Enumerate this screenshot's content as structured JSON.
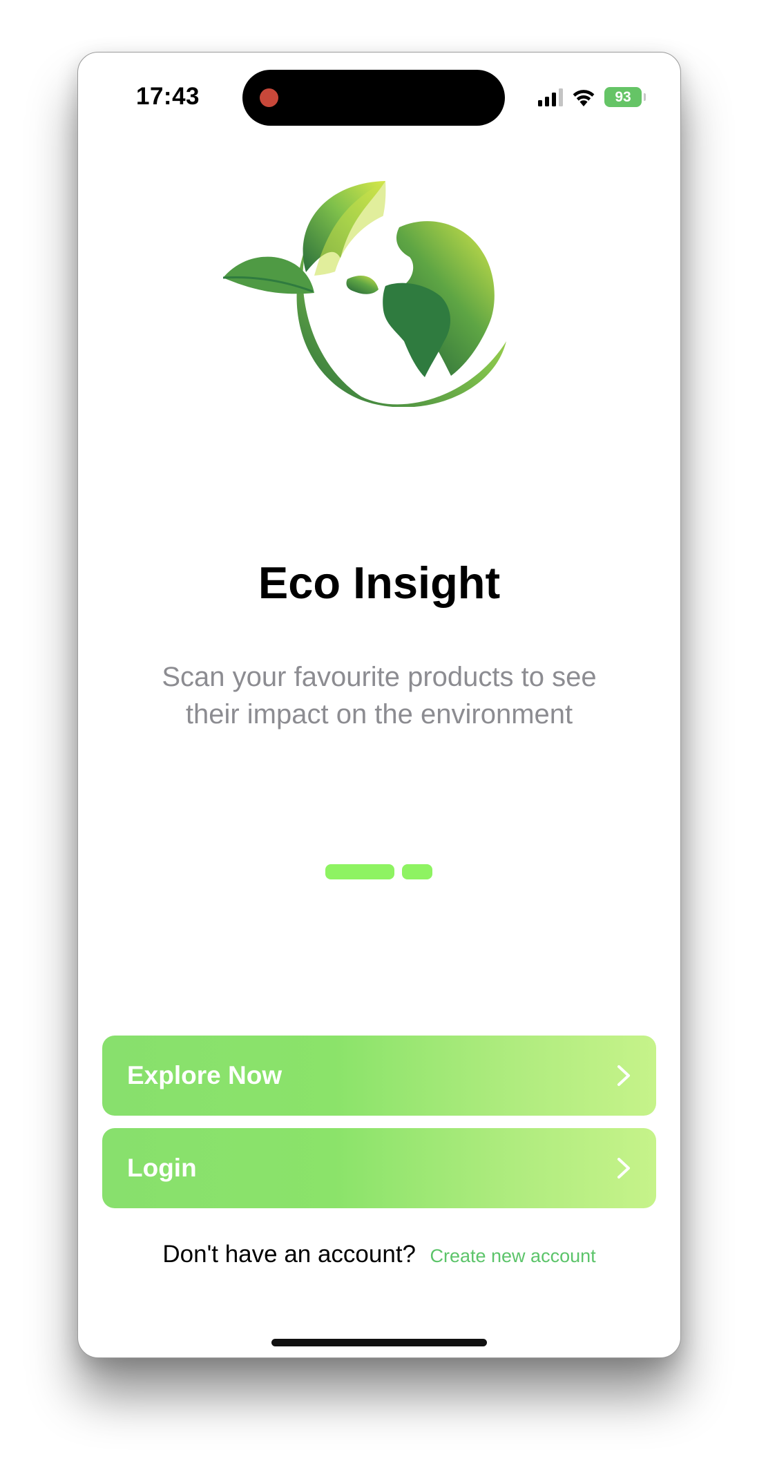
{
  "status_bar": {
    "time": "17:43",
    "battery_level": "93",
    "icons": [
      "signal-icon",
      "wifi-icon",
      "battery-charging-icon"
    ],
    "recording_indicator_color": "#c8483a"
  },
  "logo": {
    "icon": "earth-leaf-logo",
    "colors": [
      "#cfe34a",
      "#2f7b3f"
    ]
  },
  "hero": {
    "title": "Eco Insight",
    "subtitle": "Scan your favourite products to see their impact on the environment"
  },
  "pager": {
    "pages": 2,
    "current": 1,
    "color": "#8ef362"
  },
  "actions": {
    "explore_label": "Explore Now",
    "login_label": "Login",
    "accent_gradient": [
      "#88e06d",
      "#c6f38a"
    ]
  },
  "signup": {
    "prompt": "Don't have an account?",
    "link_label": "Create new account",
    "link_color": "#5cc46a"
  }
}
